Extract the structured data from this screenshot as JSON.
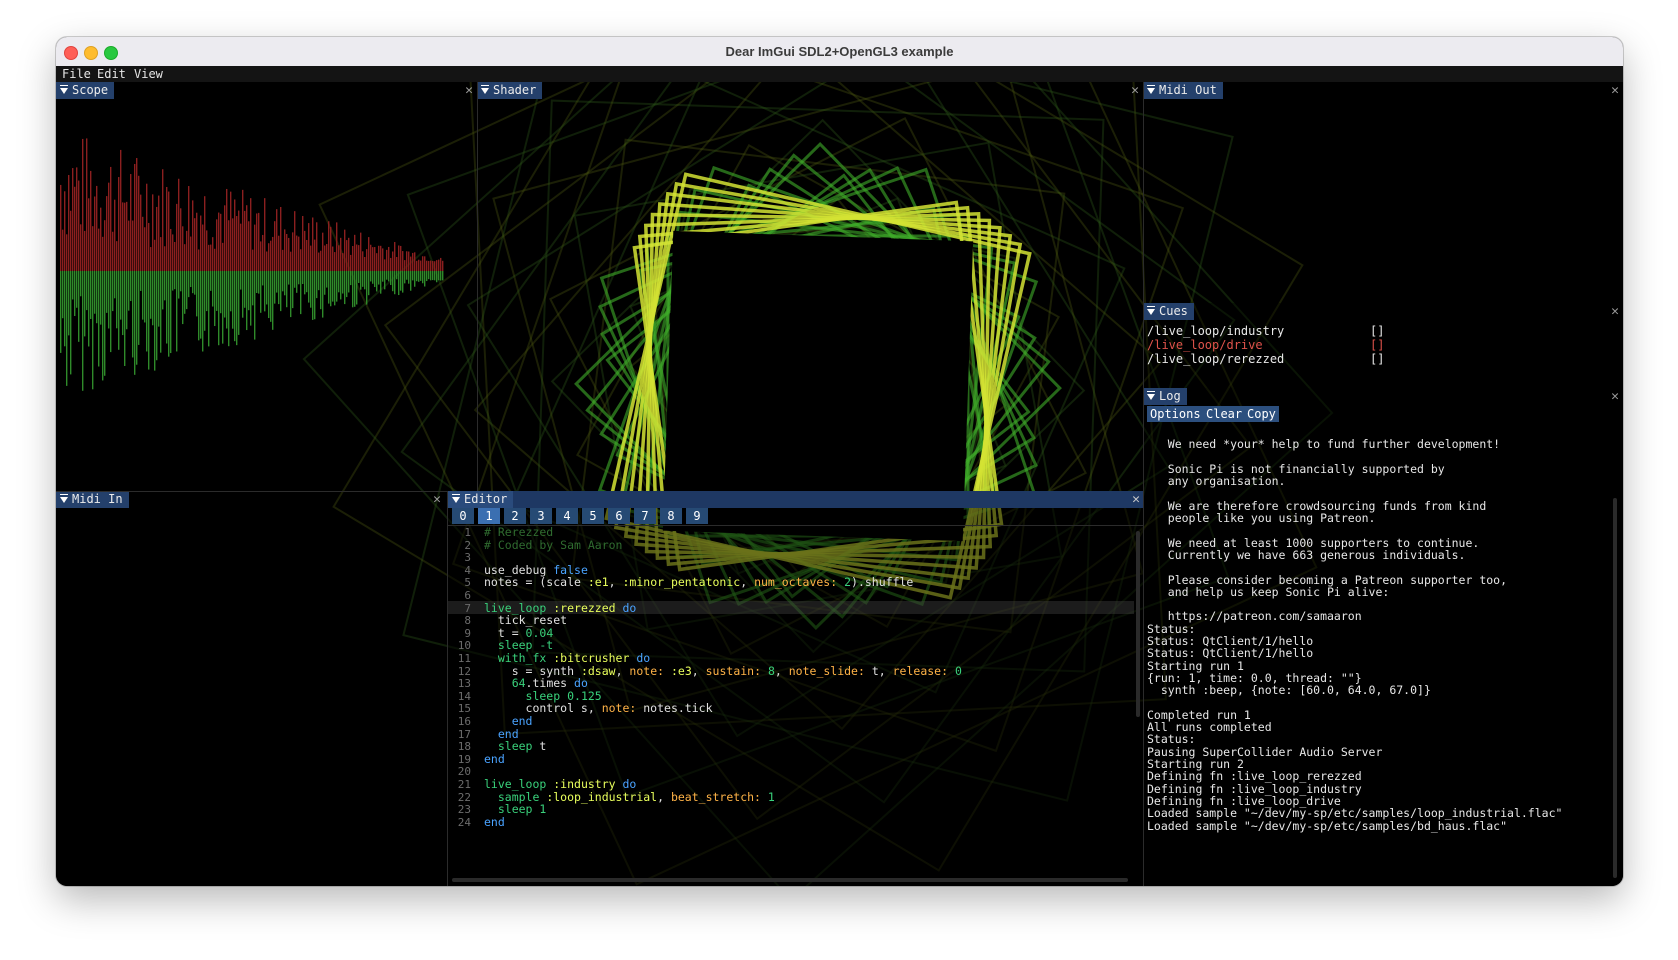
{
  "window": {
    "title": "Dear ImGui SDL2+OpenGL3 example"
  },
  "menu": [
    "File",
    "Edit",
    "View"
  ],
  "panels": {
    "scope": {
      "title": "Scope"
    },
    "shader": {
      "title": "Shader"
    },
    "midi_out": {
      "title": "Midi Out"
    },
    "cues": {
      "title": "Cues",
      "items": [
        {
          "path": "/live_loop/industry",
          "value": "[]",
          "color": "#e8e8e8"
        },
        {
          "path": "/live_loop/drive",
          "value": "[]",
          "color": "#e0534b"
        },
        {
          "path": "/live_loop/rerezzed",
          "value": "[]",
          "color": "#e8e8e8"
        }
      ]
    },
    "log": {
      "title": "Log",
      "buttons": [
        "Options",
        "Clear",
        "Copy"
      ],
      "lines": [
        "",
        "   We need *your* help to fund further development!",
        "",
        "   Sonic Pi is not financially supported by",
        "   any organisation.",
        "",
        "   We are therefore crowdsourcing funds from kind",
        "   people like you using Patreon.",
        "",
        "   We need at least 1000 supporters to continue.",
        "   Currently we have 663 generous individuals.",
        "",
        "   Please consider becoming a Patreon supporter too,",
        "   and help us keep Sonic Pi alive:",
        "",
        "   https://patreon.com/samaaron",
        "Status:",
        "Status: QtClient/1/hello",
        "Status: QtClient/1/hello",
        "Starting run 1",
        "{run: 1, time: 0.0, thread: \"\"}",
        "  synth :beep, {note: [60.0, 64.0, 67.0]}",
        "",
        "Completed run 1",
        "All runs completed",
        "Status:",
        "Pausing SuperCollider Audio Server",
        "Starting run 2",
        "Defining fn :live_loop_rerezzed",
        "Defining fn :live_loop_industry",
        "Defining fn :live_loop_drive",
        "Loaded sample \"~/dev/my-sp/etc/samples/loop_industrial.flac\"",
        "Loaded sample \"~/dev/my-sp/etc/samples/bd_haus.flac\""
      ]
    },
    "midi_in": {
      "title": "Midi In"
    },
    "editor": {
      "title": "Editor",
      "tabs": [
        "0",
        "1",
        "2",
        "3",
        "4",
        "5",
        "6",
        "7",
        "8",
        "9"
      ],
      "active_tab": "1",
      "current_line": 7,
      "lines": [
        [
          {
            "t": "# Rerezzed",
            "c": "com"
          }
        ],
        [
          {
            "t": "# Coded by Sam Aaron",
            "c": "com"
          }
        ],
        [],
        [
          {
            "t": "use_debug ",
            "c": "fn"
          },
          {
            "t": "false",
            "c": "kw"
          }
        ],
        [
          {
            "t": "notes = (scale ",
            "c": "fn"
          },
          {
            "t": ":e1",
            "c": "sym"
          },
          {
            "t": ", ",
            "c": "fn"
          },
          {
            "t": ":minor_pentatonic",
            "c": "sym"
          },
          {
            "t": ", ",
            "c": "fn"
          },
          {
            "t": "num_octaves:",
            "c": "str"
          },
          {
            "t": " ",
            "c": "fn"
          },
          {
            "t": "2",
            "c": "num"
          },
          {
            "t": ").shuffle",
            "c": "fn"
          }
        ],
        [],
        [
          {
            "t": "live_loop ",
            "c": "num"
          },
          {
            "t": ":rerezzed",
            "c": "sym"
          },
          {
            "t": " do",
            "c": "kw"
          }
        ],
        [
          {
            "t": "  tick_reset",
            "c": "fn"
          }
        ],
        [
          {
            "t": "  t = ",
            "c": "fn"
          },
          {
            "t": "0.04",
            "c": "num"
          }
        ],
        [
          {
            "t": "  sleep -t",
            "c": "num"
          }
        ],
        [
          {
            "t": "  with_fx ",
            "c": "num"
          },
          {
            "t": ":bitcrusher",
            "c": "sym"
          },
          {
            "t": " do",
            "c": "kw"
          }
        ],
        [
          {
            "t": "    s = synth ",
            "c": "fn"
          },
          {
            "t": ":dsaw",
            "c": "sym"
          },
          {
            "t": ", ",
            "c": "fn"
          },
          {
            "t": "note:",
            "c": "str"
          },
          {
            "t": " ",
            "c": "fn"
          },
          {
            "t": ":e3",
            "c": "sym"
          },
          {
            "t": ", ",
            "c": "fn"
          },
          {
            "t": "sustain:",
            "c": "str"
          },
          {
            "t": " ",
            "c": "fn"
          },
          {
            "t": "8",
            "c": "num"
          },
          {
            "t": ", ",
            "c": "fn"
          },
          {
            "t": "note_slide:",
            "c": "str"
          },
          {
            "t": " t, ",
            "c": "fn"
          },
          {
            "t": "release:",
            "c": "str"
          },
          {
            "t": " ",
            "c": "fn"
          },
          {
            "t": "0",
            "c": "num"
          }
        ],
        [
          {
            "t": "    64",
            "c": "num"
          },
          {
            "t": ".times",
            "c": "fn"
          },
          {
            "t": " do",
            "c": "kw"
          }
        ],
        [
          {
            "t": "      sleep ",
            "c": "num"
          },
          {
            "t": "0.125",
            "c": "num"
          }
        ],
        [
          {
            "t": "      control s, ",
            "c": "fn"
          },
          {
            "t": "note:",
            "c": "str"
          },
          {
            "t": " notes.tick",
            "c": "fn"
          }
        ],
        [
          {
            "t": "    end",
            "c": "kw"
          }
        ],
        [
          {
            "t": "  end",
            "c": "kw"
          }
        ],
        [
          {
            "t": "  sleep ",
            "c": "num"
          },
          {
            "t": "t",
            "c": "fn"
          }
        ],
        [
          {
            "t": "end",
            "c": "kw"
          }
        ],
        [],
        [
          {
            "t": "live_loop ",
            "c": "num"
          },
          {
            "t": ":industry",
            "c": "sym"
          },
          {
            "t": " do",
            "c": "kw"
          }
        ],
        [
          {
            "t": "  sample ",
            "c": "num"
          },
          {
            "t": ":loop_industrial",
            "c": "sym"
          },
          {
            "t": ", ",
            "c": "fn"
          },
          {
            "t": "beat_stretch:",
            "c": "str"
          },
          {
            "t": " ",
            "c": "fn"
          },
          {
            "t": "1",
            "c": "num"
          }
        ],
        [
          {
            "t": "  sleep ",
            "c": "num"
          },
          {
            "t": "1",
            "c": "num"
          }
        ],
        [
          {
            "t": "end",
            "c": "kw"
          }
        ]
      ]
    }
  },
  "colors": {
    "title_tab": "#24406b",
    "scope_left": "#8b1f1f",
    "scope_right": "#2f8a2a",
    "shader_lines": "#d4e334"
  }
}
